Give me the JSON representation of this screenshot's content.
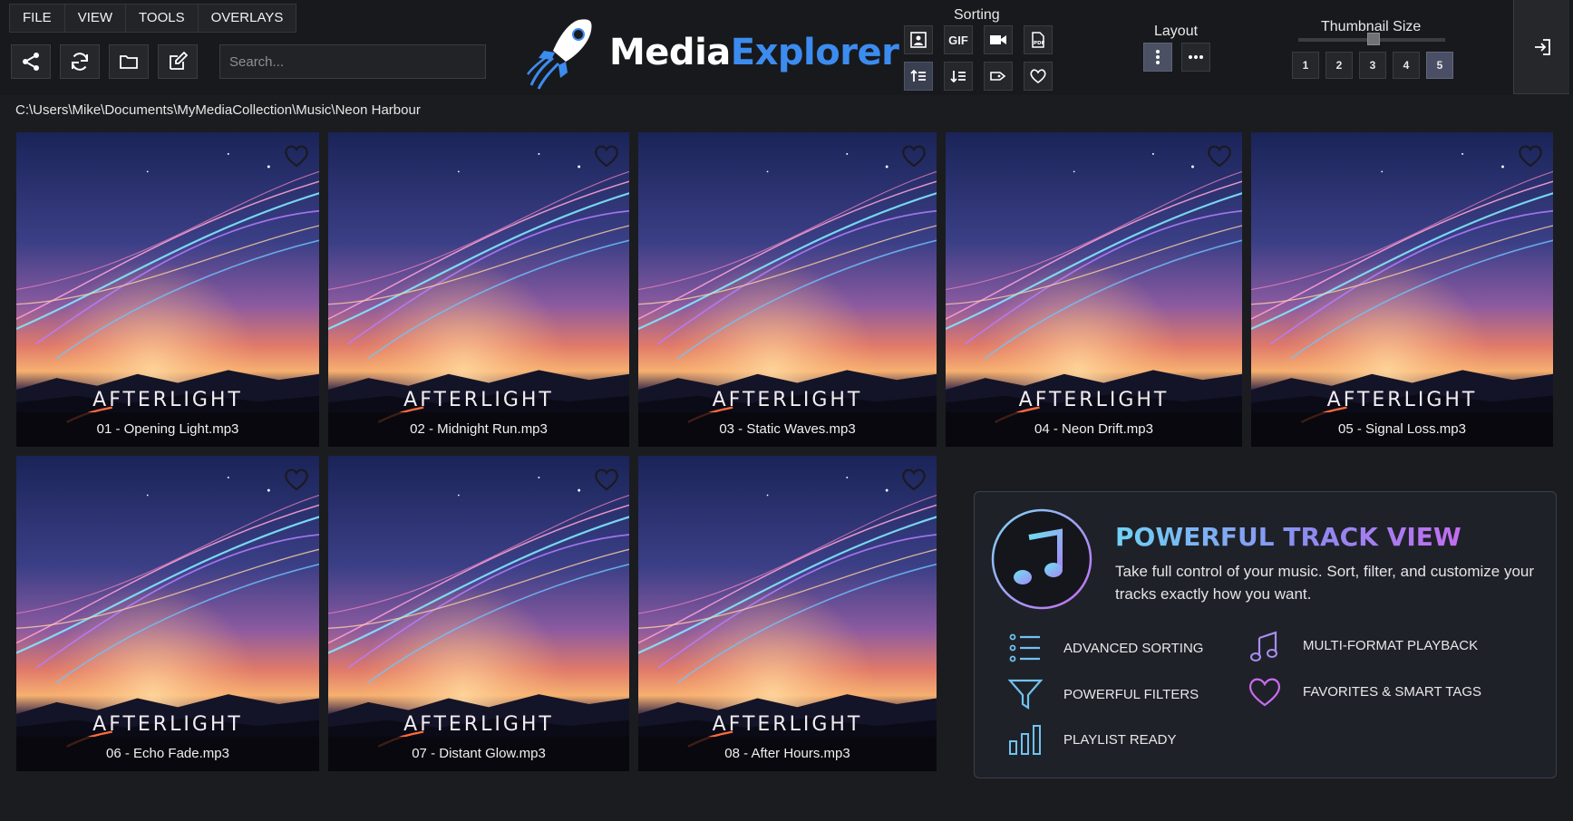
{
  "app": {
    "name_part1": "Media",
    "name_part2": "Explorer"
  },
  "menu": [
    "FILE",
    "VIEW",
    "TOOLS",
    "OVERLAYS"
  ],
  "toolbar": {
    "share_icon": "share-icon",
    "refresh_icon": "refresh-icon",
    "folder_icon": "folder-icon",
    "edit_icon": "edit-icon"
  },
  "search": {
    "placeholder": "Search...",
    "value": ""
  },
  "sorting": {
    "title": "Sorting",
    "gif_label": "GIF",
    "pdf_label": "PDF"
  },
  "layout": {
    "title": "Layout",
    "active": "vertical"
  },
  "thumbnail_size": {
    "title": "Thumbnail Size",
    "options": [
      "1",
      "2",
      "3",
      "4",
      "5"
    ],
    "selected": "5"
  },
  "path": "C:\\Users\\Mike\\Documents\\MyMediaCollection\\Music\\Neon Harbour",
  "album_art_title": "AFTERLIGHT",
  "tracks": [
    "01 - Opening Light.mp3",
    "02 - Midnight Run.mp3",
    "03 - Static Waves.mp3",
    "04 - Neon Drift.mp3",
    "05 - Signal Loss.mp3",
    "06 - Echo Fade.mp3",
    "07 - Distant Glow.mp3",
    "08 - After Hours.mp3"
  ],
  "feature_panel": {
    "title": "POWERFUL TRACK VIEW",
    "description": "Take full control of your music. Sort, filter, and customize your tracks exactly how you want.",
    "features": [
      "ADVANCED SORTING",
      "MULTI-FORMAT PLAYBACK",
      "POWERFUL FILTERS",
      "FAVORITES & SMART TAGS",
      "PLAYLIST READY"
    ]
  },
  "colors": {
    "accent_blue": "#3c8cf0",
    "accent_purple": "#c26df0",
    "accent_cyan": "#6fd3f5",
    "background": "#1b1c1f"
  }
}
